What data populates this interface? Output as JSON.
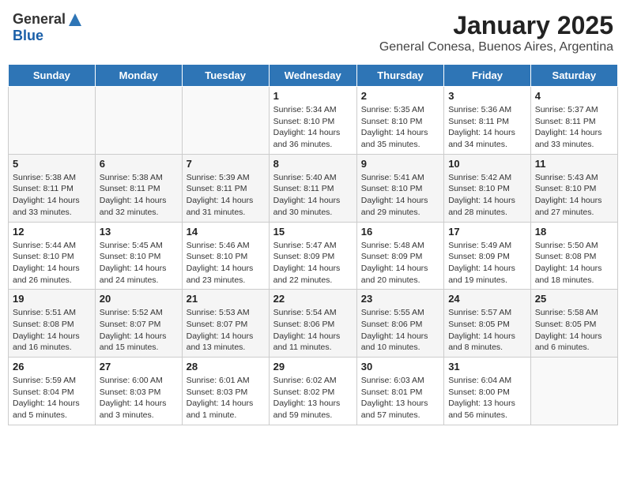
{
  "header": {
    "logo_general": "General",
    "logo_blue": "Blue",
    "title": "January 2025",
    "subtitle": "General Conesa, Buenos Aires, Argentina"
  },
  "days_of_week": [
    "Sunday",
    "Monday",
    "Tuesday",
    "Wednesday",
    "Thursday",
    "Friday",
    "Saturday"
  ],
  "weeks": [
    [
      {
        "num": "",
        "detail": ""
      },
      {
        "num": "",
        "detail": ""
      },
      {
        "num": "",
        "detail": ""
      },
      {
        "num": "1",
        "detail": "Sunrise: 5:34 AM\nSunset: 8:10 PM\nDaylight: 14 hours\nand 36 minutes."
      },
      {
        "num": "2",
        "detail": "Sunrise: 5:35 AM\nSunset: 8:10 PM\nDaylight: 14 hours\nand 35 minutes."
      },
      {
        "num": "3",
        "detail": "Sunrise: 5:36 AM\nSunset: 8:11 PM\nDaylight: 14 hours\nand 34 minutes."
      },
      {
        "num": "4",
        "detail": "Sunrise: 5:37 AM\nSunset: 8:11 PM\nDaylight: 14 hours\nand 33 minutes."
      }
    ],
    [
      {
        "num": "5",
        "detail": "Sunrise: 5:38 AM\nSunset: 8:11 PM\nDaylight: 14 hours\nand 33 minutes."
      },
      {
        "num": "6",
        "detail": "Sunrise: 5:38 AM\nSunset: 8:11 PM\nDaylight: 14 hours\nand 32 minutes."
      },
      {
        "num": "7",
        "detail": "Sunrise: 5:39 AM\nSunset: 8:11 PM\nDaylight: 14 hours\nand 31 minutes."
      },
      {
        "num": "8",
        "detail": "Sunrise: 5:40 AM\nSunset: 8:11 PM\nDaylight: 14 hours\nand 30 minutes."
      },
      {
        "num": "9",
        "detail": "Sunrise: 5:41 AM\nSunset: 8:10 PM\nDaylight: 14 hours\nand 29 minutes."
      },
      {
        "num": "10",
        "detail": "Sunrise: 5:42 AM\nSunset: 8:10 PM\nDaylight: 14 hours\nand 28 minutes."
      },
      {
        "num": "11",
        "detail": "Sunrise: 5:43 AM\nSunset: 8:10 PM\nDaylight: 14 hours\nand 27 minutes."
      }
    ],
    [
      {
        "num": "12",
        "detail": "Sunrise: 5:44 AM\nSunset: 8:10 PM\nDaylight: 14 hours\nand 26 minutes."
      },
      {
        "num": "13",
        "detail": "Sunrise: 5:45 AM\nSunset: 8:10 PM\nDaylight: 14 hours\nand 24 minutes."
      },
      {
        "num": "14",
        "detail": "Sunrise: 5:46 AM\nSunset: 8:10 PM\nDaylight: 14 hours\nand 23 minutes."
      },
      {
        "num": "15",
        "detail": "Sunrise: 5:47 AM\nSunset: 8:09 PM\nDaylight: 14 hours\nand 22 minutes."
      },
      {
        "num": "16",
        "detail": "Sunrise: 5:48 AM\nSunset: 8:09 PM\nDaylight: 14 hours\nand 20 minutes."
      },
      {
        "num": "17",
        "detail": "Sunrise: 5:49 AM\nSunset: 8:09 PM\nDaylight: 14 hours\nand 19 minutes."
      },
      {
        "num": "18",
        "detail": "Sunrise: 5:50 AM\nSunset: 8:08 PM\nDaylight: 14 hours\nand 18 minutes."
      }
    ],
    [
      {
        "num": "19",
        "detail": "Sunrise: 5:51 AM\nSunset: 8:08 PM\nDaylight: 14 hours\nand 16 minutes."
      },
      {
        "num": "20",
        "detail": "Sunrise: 5:52 AM\nSunset: 8:07 PM\nDaylight: 14 hours\nand 15 minutes."
      },
      {
        "num": "21",
        "detail": "Sunrise: 5:53 AM\nSunset: 8:07 PM\nDaylight: 14 hours\nand 13 minutes."
      },
      {
        "num": "22",
        "detail": "Sunrise: 5:54 AM\nSunset: 8:06 PM\nDaylight: 14 hours\nand 11 minutes."
      },
      {
        "num": "23",
        "detail": "Sunrise: 5:55 AM\nSunset: 8:06 PM\nDaylight: 14 hours\nand 10 minutes."
      },
      {
        "num": "24",
        "detail": "Sunrise: 5:57 AM\nSunset: 8:05 PM\nDaylight: 14 hours\nand 8 minutes."
      },
      {
        "num": "25",
        "detail": "Sunrise: 5:58 AM\nSunset: 8:05 PM\nDaylight: 14 hours\nand 6 minutes."
      }
    ],
    [
      {
        "num": "26",
        "detail": "Sunrise: 5:59 AM\nSunset: 8:04 PM\nDaylight: 14 hours\nand 5 minutes."
      },
      {
        "num": "27",
        "detail": "Sunrise: 6:00 AM\nSunset: 8:03 PM\nDaylight: 14 hours\nand 3 minutes."
      },
      {
        "num": "28",
        "detail": "Sunrise: 6:01 AM\nSunset: 8:03 PM\nDaylight: 14 hours\nand 1 minute."
      },
      {
        "num": "29",
        "detail": "Sunrise: 6:02 AM\nSunset: 8:02 PM\nDaylight: 13 hours\nand 59 minutes."
      },
      {
        "num": "30",
        "detail": "Sunrise: 6:03 AM\nSunset: 8:01 PM\nDaylight: 13 hours\nand 57 minutes."
      },
      {
        "num": "31",
        "detail": "Sunrise: 6:04 AM\nSunset: 8:00 PM\nDaylight: 13 hours\nand 56 minutes."
      },
      {
        "num": "",
        "detail": ""
      }
    ]
  ]
}
